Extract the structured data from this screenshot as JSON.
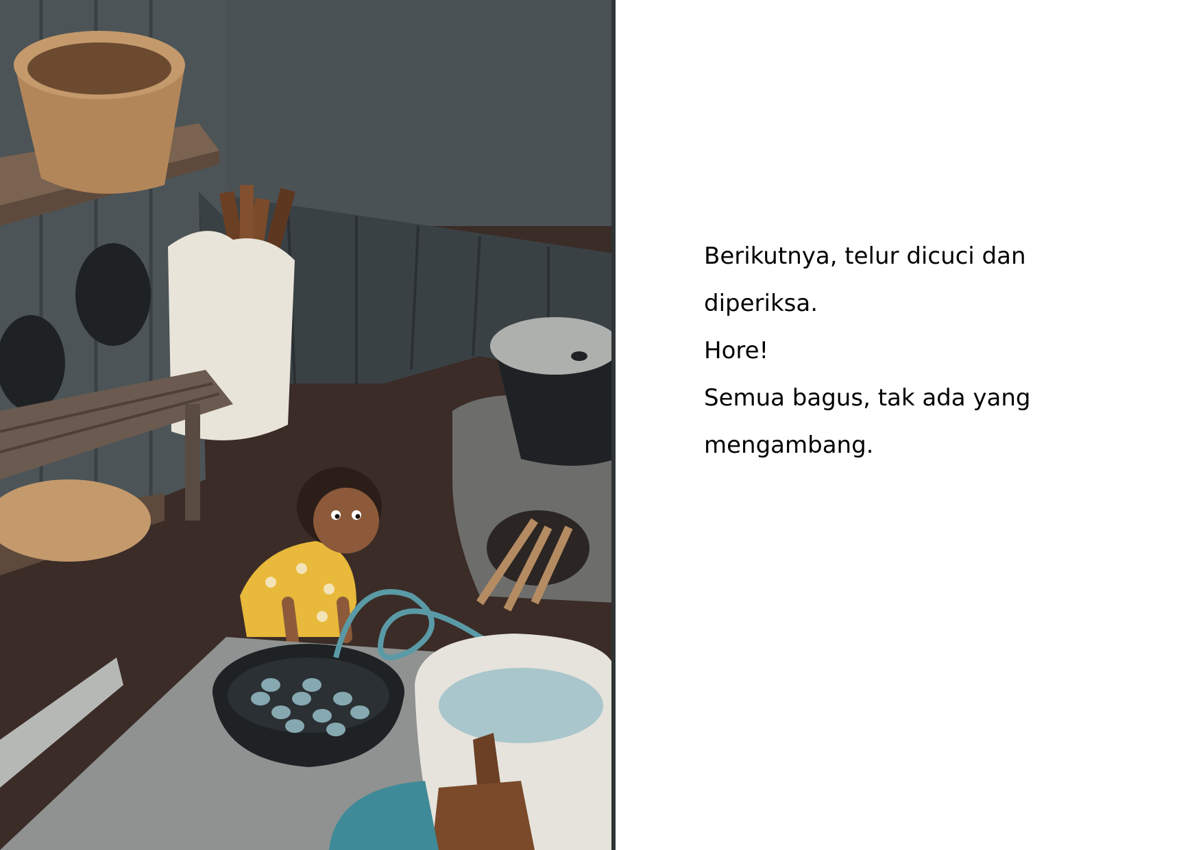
{
  "story": {
    "lines": [
      "Berikutnya, telur dicuci dan",
      "diperiksa.",
      "Hore!",
      "Semua bagus, tak ada yang",
      "mengambang."
    ]
  },
  "colors": {
    "background": "#ffffff",
    "text": "#000000",
    "wall": "#3f4649",
    "floor": "#3b2c27",
    "girl_dress": "#e8b93a",
    "water": "#a9c6cc"
  }
}
